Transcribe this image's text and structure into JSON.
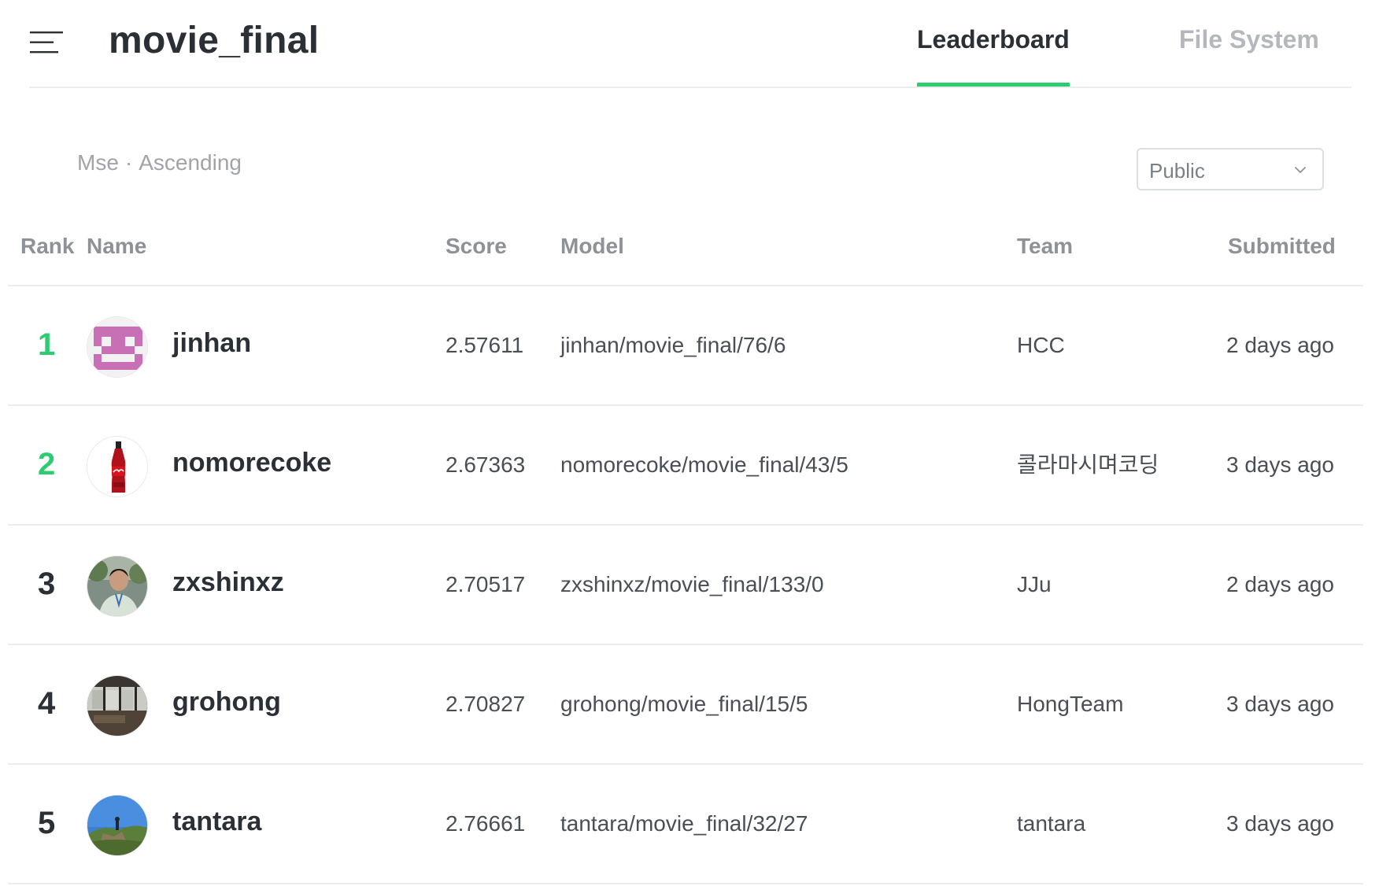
{
  "header": {
    "title": "movie_final",
    "tabs": [
      {
        "label": "Leaderboard",
        "active": true
      },
      {
        "label": "File System",
        "active": false
      }
    ]
  },
  "colors": {
    "accent": "#2ecc71",
    "text_dark": "#2b2f36",
    "text_muted": "#a0a4a8"
  },
  "metric": {
    "name": "Mse",
    "separator": "·",
    "order": "Ascending"
  },
  "filter": {
    "selected": "Public"
  },
  "table": {
    "columns": [
      "Rank",
      "Name",
      "Score",
      "Model",
      "Team",
      "Submitted"
    ],
    "rows": [
      {
        "rank": "1",
        "name": "jinhan",
        "score": "2.57611",
        "model": "jinhan/movie_final/76/6",
        "team": "HCC",
        "submitted": "2 days ago",
        "avatar": "pixel-pattern-avatar"
      },
      {
        "rank": "2",
        "name": "nomorecoke",
        "score": "2.67363",
        "model": "nomorecoke/movie_final/43/5",
        "team": "콜라마시며코딩",
        "submitted": "3 days ago",
        "avatar": "coke-bottle-avatar"
      },
      {
        "rank": "3",
        "name": "zxshinxz",
        "score": "2.70517",
        "model": "zxshinxz/movie_final/133/0",
        "team": "JJu",
        "submitted": "2 days ago",
        "avatar": "person-photo-avatar"
      },
      {
        "rank": "4",
        "name": "grohong",
        "score": "2.70827",
        "model": "grohong/movie_final/15/5",
        "team": "HongTeam",
        "submitted": "3 days ago",
        "avatar": "room-photo-avatar"
      },
      {
        "rank": "5",
        "name": "tantara",
        "score": "2.76661",
        "model": "tantara/movie_final/32/27",
        "team": "tantara",
        "submitted": "3 days ago",
        "avatar": "landscape-photo-avatar"
      }
    ]
  }
}
